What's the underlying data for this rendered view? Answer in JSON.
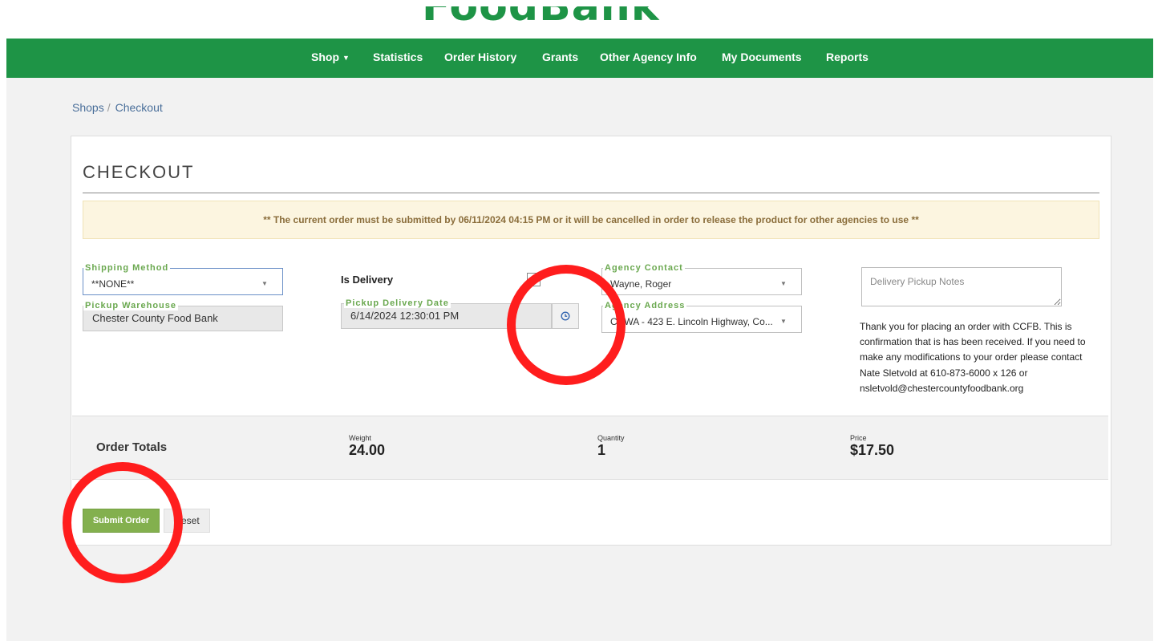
{
  "header": {
    "logo_text": "FoodBank"
  },
  "nav": {
    "shop": "Shop",
    "statistics": "Statistics",
    "order_history": "Order History",
    "grants": "Grants",
    "other_agency_info": "Other Agency Info",
    "my_documents": "My Documents",
    "reports": "Reports"
  },
  "breadcrumb": {
    "shops": "Shops",
    "separator": "/",
    "current": "Checkout"
  },
  "checkout": {
    "title": "CHECKOUT",
    "alert": "** The current order must be submitted by 06/11/2024 04:15 PM or it will be cancelled in order to release the product for other agencies to use **",
    "shipping_method": {
      "label": "Shipping Method",
      "value": "**NONE**"
    },
    "pickup_warehouse": {
      "label": "Pickup Warehouse",
      "value": "Chester County Food Bank"
    },
    "is_delivery_label": "Is Delivery",
    "pickup_delivery_date": {
      "label": "Pickup Delivery Date",
      "value": "6/14/2024 12:30:01 PM"
    },
    "agency_contact": {
      "label": "Agency Contact",
      "value": "Wayne, Roger"
    },
    "agency_address": {
      "label": "Agency Address",
      "value": "CCWA - 423 E. Lincoln Highway, Co..."
    },
    "notes_placeholder": "Delivery Pickup Notes",
    "thank_you": "Thank you for placing an order with CCFB. This is confirmation that is has been received. If you need to make any modifications to your order please contact Nate Sletvold at 610-873-6000 x 126 or nsletvold@chestercountyfoodbank.org"
  },
  "totals": {
    "title": "Order Totals",
    "weight_label": "Weight",
    "weight_value": "24.00",
    "quantity_label": "Quantity",
    "quantity_value": "1",
    "price_label": "Price",
    "price_value": "$17.50"
  },
  "buttons": {
    "submit": "Submit Order",
    "reset": "Reset"
  },
  "colors": {
    "brand_green": "#1e9446",
    "submit_green": "#83b04e",
    "annotation_red": "#ff1d1d"
  },
  "icons": {
    "shop_caret": "caret-down-icon",
    "clock": "clock-icon",
    "select_arrow": "chevron-down-icon"
  }
}
